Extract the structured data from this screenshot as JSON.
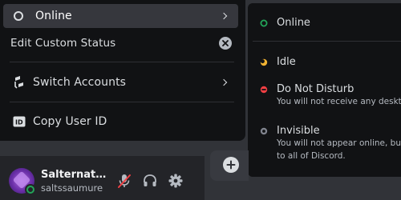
{
  "status_menu": {
    "current_status": "Online",
    "edit_custom_status": "Edit Custom Status",
    "switch_accounts": "Switch Accounts",
    "copy_user_id": "Copy User ID"
  },
  "status_submenu": {
    "online": {
      "label": "Online",
      "color": "#23a559"
    },
    "idle": {
      "label": "Idle",
      "color": "#f0b232"
    },
    "dnd": {
      "label": "Do Not Disturb",
      "description": "You will not receive any desktop",
      "color": "#f23f43"
    },
    "invisible": {
      "label": "Invisible",
      "description_line1": "You will not appear online, but",
      "description_line2": "to all of Discord.",
      "color": "#80848e"
    }
  },
  "user_panel": {
    "display_name": "Salternato…",
    "username": "saltssaumure",
    "status_color": "#23a559"
  },
  "icons": {
    "status": "status-ring-icon",
    "clear": "clear-x-icon",
    "switch_accounts": "switch-accounts-icon",
    "copy_id": "id-badge-icon",
    "microphone_muted": "microphone-muted-icon",
    "headphones": "headphones-icon",
    "settings": "gear-icon",
    "add": "plus-icon"
  }
}
